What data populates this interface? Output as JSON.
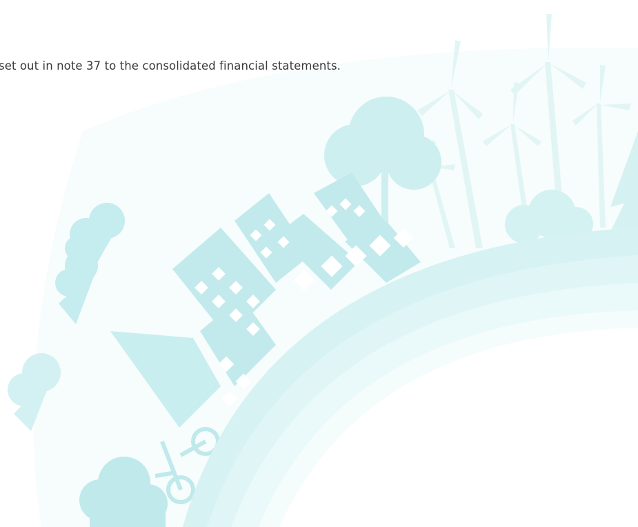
{
  "document": {
    "body_text": "set out in note 37 to the consolidated financial statements."
  },
  "illustration": {
    "description_icon": "eco-city-globe-illustration",
    "colors": {
      "light": "#e4f6f6",
      "medium": "#c8eeee",
      "dark": "#aee3e5",
      "window": "#ffffff"
    }
  }
}
